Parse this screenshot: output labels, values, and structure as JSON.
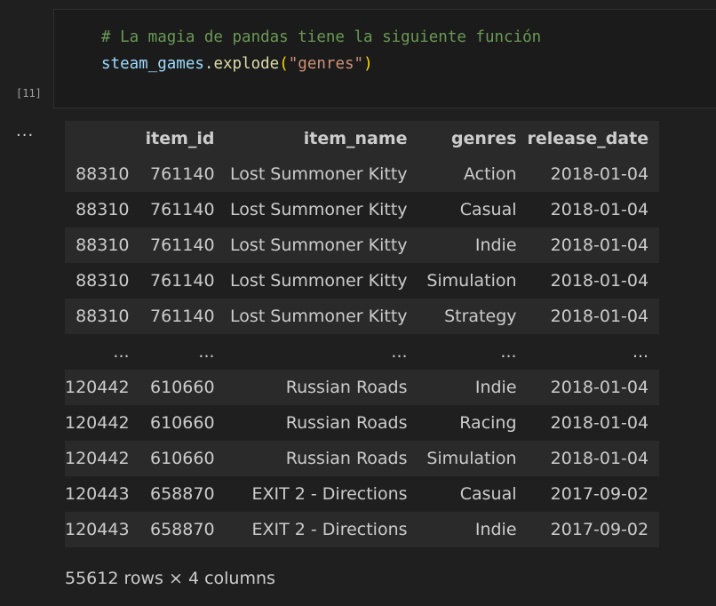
{
  "cell": {
    "execution_count": "[11]",
    "code_lines": [
      "# La magia de pandas tiene la siguiente función",
      "steam_games.explode(\"genres\")"
    ],
    "code_tokens": {
      "comment": "# La magia de pandas tiene la siguiente función",
      "var": "steam_games",
      "dot": ".",
      "func": "explode",
      "open_paren": "(",
      "string": "\"genres\"",
      "close_paren": ")"
    }
  },
  "output": {
    "menu_glyph": "...",
    "table": {
      "columns": [
        "",
        "item_id",
        "item_name",
        "genres",
        "release_date"
      ],
      "rows": [
        [
          "88310",
          "761140",
          "Lost Summoner Kitty",
          "Action",
          "2018-01-04"
        ],
        [
          "88310",
          "761140",
          "Lost Summoner Kitty",
          "Casual",
          "2018-01-04"
        ],
        [
          "88310",
          "761140",
          "Lost Summoner Kitty",
          "Indie",
          "2018-01-04"
        ],
        [
          "88310",
          "761140",
          "Lost Summoner Kitty",
          "Simulation",
          "2018-01-04"
        ],
        [
          "88310",
          "761140",
          "Lost Summoner Kitty",
          "Strategy",
          "2018-01-04"
        ],
        [
          "...",
          "...",
          "...",
          "...",
          "..."
        ],
        [
          "120442",
          "610660",
          "Russian Roads",
          "Indie",
          "2018-01-04"
        ],
        [
          "120442",
          "610660",
          "Russian Roads",
          "Racing",
          "2018-01-04"
        ],
        [
          "120442",
          "610660",
          "Russian Roads",
          "Simulation",
          "2018-01-04"
        ],
        [
          "120443",
          "658870",
          "EXIT 2 - Directions",
          "Casual",
          "2017-09-02"
        ],
        [
          "120443",
          "658870",
          "EXIT 2 - Directions",
          "Indie",
          "2017-09-02"
        ]
      ]
    },
    "shape_note": "55612 rows × 4 columns"
  },
  "colors": {
    "background": "#1f1f1f",
    "editor_background": "#1b1b1b",
    "row_stripe": "#2a2a2a",
    "comment": "#6a9955",
    "variable": "#9cdcfe",
    "function": "#dcdcaa",
    "string": "#ce9178",
    "bracket": "#ffd700"
  }
}
